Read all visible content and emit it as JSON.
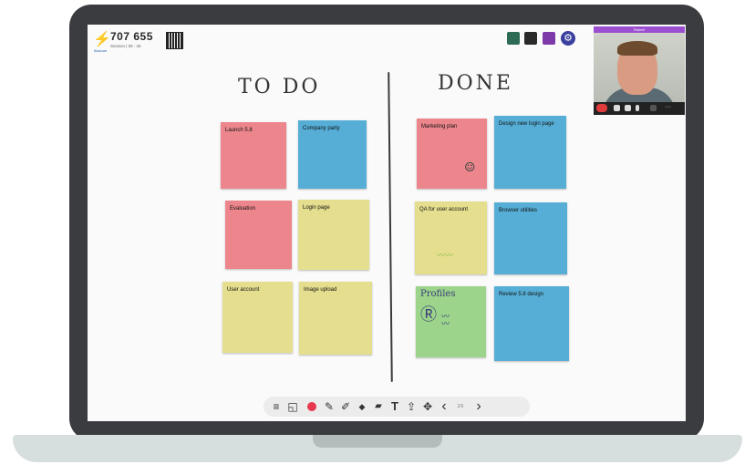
{
  "header": {
    "logo_text": "Klaxoon",
    "session_code": "707 655",
    "session_info": "Session | 06 : 45"
  },
  "participants": {
    "settings_icon": "⚙"
  },
  "video": {
    "name": "Robert",
    "controls": [
      "hang-up-icon",
      "screen-share-icon",
      "camera-icon",
      "mic-icon",
      "muted-icon",
      "more-icon"
    ],
    "more_label": "···"
  },
  "board": {
    "todo_heading": "TO DO",
    "done_heading": "DONE",
    "todo_notes": [
      {
        "text": "Launch 5.8",
        "color": "red"
      },
      {
        "text": "Company party",
        "color": "blue"
      },
      {
        "text": "Evaluation",
        "color": "red"
      },
      {
        "text": "Login page",
        "color": "yellow"
      },
      {
        "text": "User account",
        "color": "yellow"
      },
      {
        "text": "Image upload",
        "color": "yellow"
      }
    ],
    "done_notes": [
      {
        "text": "Marketing plan",
        "color": "red"
      },
      {
        "text": "Design new login page",
        "color": "blue"
      },
      {
        "text": "QA for user account",
        "color": "yellow"
      },
      {
        "text": "Browser utilities",
        "color": "blue"
      },
      {
        "text": "Profiles",
        "color": "green"
      },
      {
        "text": "Review 5.8 design",
        "color": "blue"
      }
    ]
  },
  "toolbar": {
    "menu": "≡",
    "sticky": "◱",
    "pen": "✎",
    "marker": "✐",
    "eraser": "◆",
    "shape": "▰",
    "text": "T",
    "share": "⇪",
    "move": "✥",
    "prev": "‹",
    "page": "2/6",
    "next": "›"
  },
  "colors": {
    "note_red": "#ec868c",
    "note_blue": "#56aed6",
    "note_yellow": "#e4de8e",
    "note_green": "#9bd48a",
    "pen_color": "#e6384e",
    "accent_purple": "#9b4fd0"
  }
}
